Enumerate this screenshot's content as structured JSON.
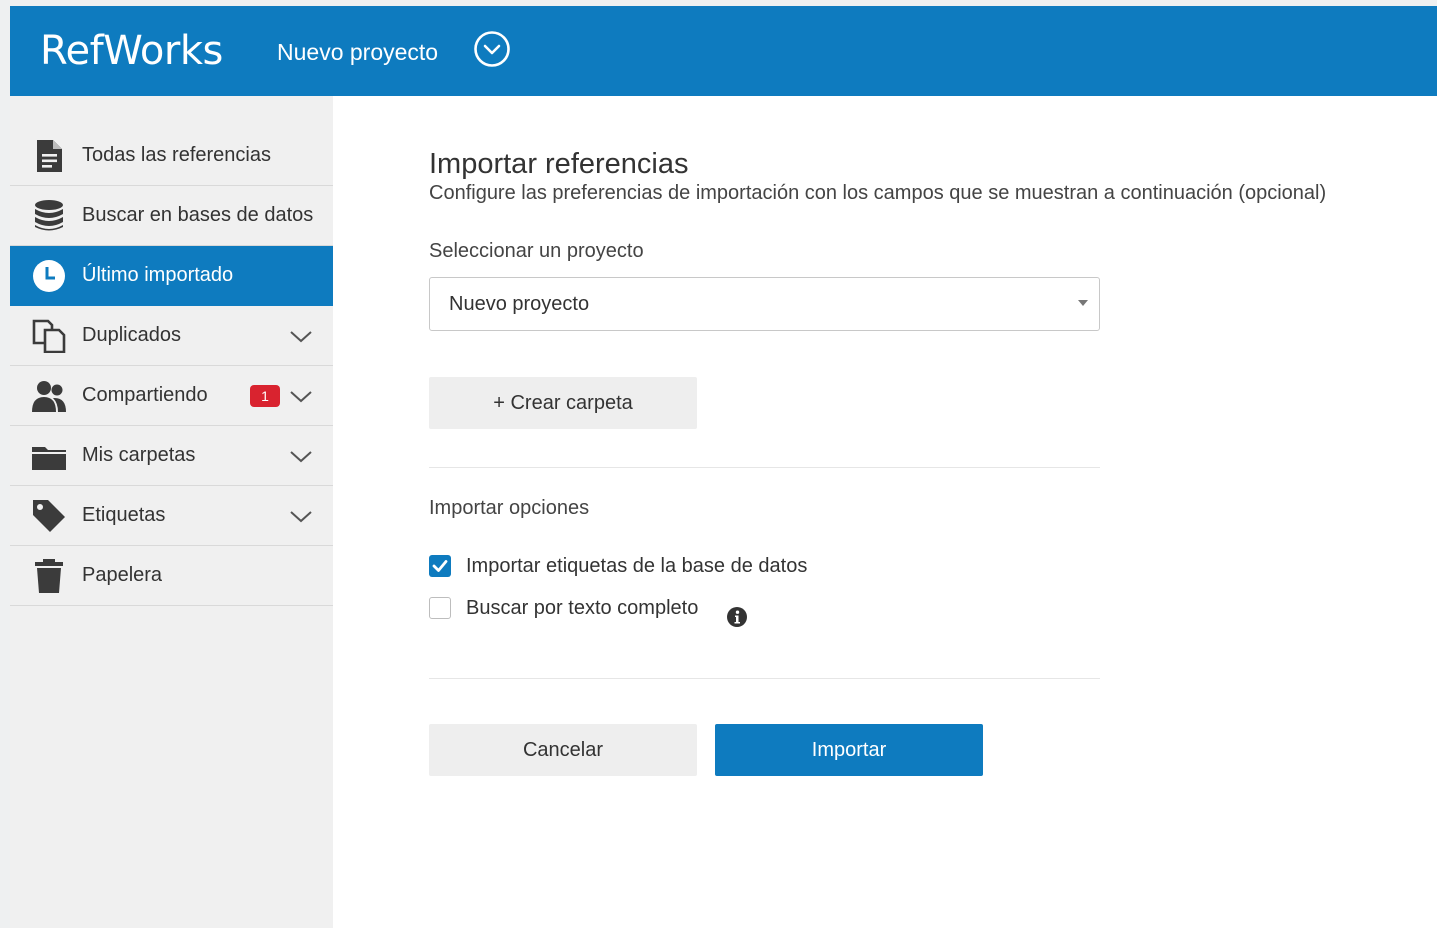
{
  "header": {
    "logo": "RefWorks",
    "project_name": "Nuevo proyecto"
  },
  "sidebar": {
    "items": [
      {
        "label": "Todas las referencias",
        "icon": "document-icon"
      },
      {
        "label": "Buscar en bases de datos",
        "icon": "database-icon"
      },
      {
        "label": "Último importado",
        "icon": "clock-icon",
        "active": true
      },
      {
        "label": "Duplicados",
        "icon": "duplicates-icon",
        "expandable": true
      },
      {
        "label": "Compartiendo",
        "icon": "users-icon",
        "expandable": true,
        "badge": "1"
      },
      {
        "label": "Mis carpetas",
        "icon": "folder-icon",
        "expandable": true
      },
      {
        "label": "Etiquetas",
        "icon": "tag-icon",
        "expandable": true
      },
      {
        "label": "Papelera",
        "icon": "trash-icon"
      }
    ]
  },
  "main": {
    "title": "Importar referencias",
    "subtitle": "Configure las preferencias de importación con los campos que se muestran a continuación (opcional)",
    "project_label": "Seleccionar un proyecto",
    "project_select_value": "Nuevo proyecto",
    "create_folder_label": "+ Crear carpeta",
    "options_label": "Importar opciones",
    "options": [
      {
        "label": "Importar etiquetas de la base de datos",
        "checked": true
      },
      {
        "label": "Buscar por texto completo",
        "checked": false,
        "info": true
      }
    ],
    "cancel_label": "Cancelar",
    "import_label": "Importar"
  },
  "colors": {
    "brand_blue": "#0e7bbf",
    "badge_red": "#d9232f"
  }
}
